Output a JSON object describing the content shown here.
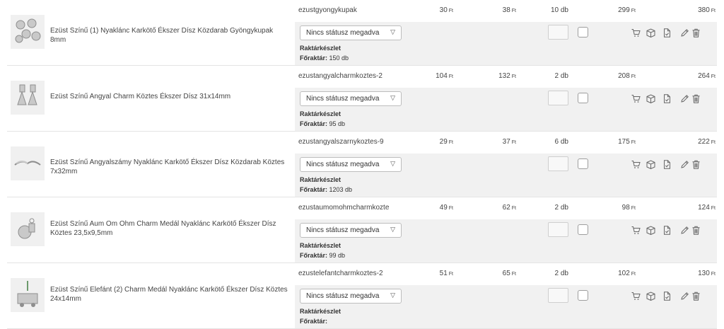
{
  "status_placeholder": "Nincs státusz megadva",
  "stock_label": "Raktárkészlet",
  "warehouse_label": "Főraktár:",
  "currency": "Ft",
  "icons": [
    "cart-icon",
    "box-icon",
    "document-icon",
    "pencil-icon",
    "trash-icon"
  ],
  "rows": [
    {
      "name": "Ezüst Színű (1) Nyaklánc Karkötő Ékszer Dísz Közdarab Gyöngykupak 8mm",
      "sku": "ezustgyongykupak",
      "price_net": "30",
      "price_gross": "38",
      "qty": "10 db",
      "total_net": "299",
      "total_gross": "380",
      "warehouse": "150 db"
    },
    {
      "name": "Ezüst Színű Angyal Charm Köztes Ékszer Dísz 31x14mm",
      "sku": "ezustangyalcharmkoztes-2",
      "price_net": "104",
      "price_gross": "132",
      "qty": "2 db",
      "total_net": "208",
      "total_gross": "264",
      "warehouse": "95 db"
    },
    {
      "name": "Ezüst Színű Angyalszámy Nyaklánc Karkötő Ékszer Dísz Közdarab Köztes 7x32mm",
      "sku": "ezustangyalszarnykoztes-9",
      "price_net": "29",
      "price_gross": "37",
      "qty": "6 db",
      "total_net": "175",
      "total_gross": "222",
      "warehouse": "1203 db"
    },
    {
      "name": "Ezüst Színű Aum Om Ohm Charm Medál Nyaklánc Karkötő Ékszer Dísz Köztes 23,5x9,5mm",
      "sku": "ezustaumomohmcharmkoztes",
      "price_net": "49",
      "price_gross": "62",
      "qty": "2 db",
      "total_net": "98",
      "total_gross": "124",
      "warehouse": "99 db"
    },
    {
      "name": "Ezüst Színű Elefánt (2) Charm Medál Nyaklánc Karkötő Ékszer Dísz Köztes 24x14mm",
      "sku": "ezustelefantcharmkoztes-2",
      "price_net": "51",
      "price_gross": "65",
      "qty": "2 db",
      "total_net": "102",
      "total_gross": "130",
      "warehouse": ""
    }
  ]
}
